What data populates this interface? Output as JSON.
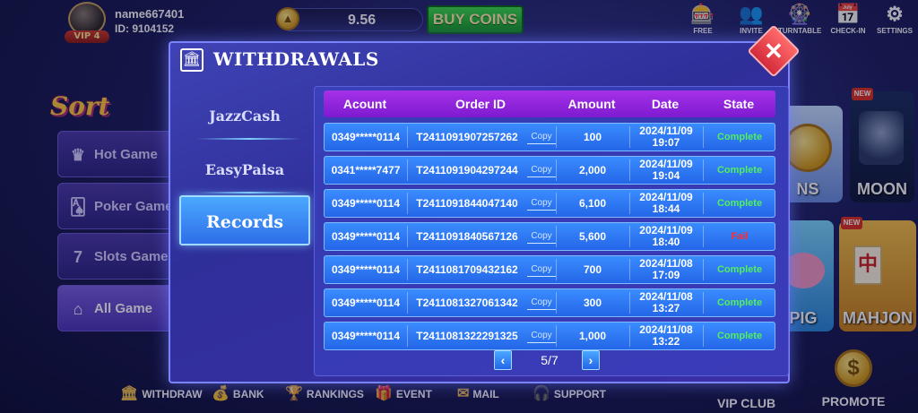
{
  "user": {
    "name": "name667401",
    "id": "ID: 9104152",
    "vip": "VIP 4"
  },
  "balance": "9.56",
  "buy_coins": "BUY COINS",
  "top_icons": [
    {
      "label": "FREE",
      "icon": "slot-machine-icon",
      "glyph": "🎰"
    },
    {
      "label": "INVITE",
      "icon": "invite-icon",
      "glyph": "👥"
    },
    {
      "label": "TURNTABLE",
      "icon": "turntable-icon",
      "glyph": "🎡"
    },
    {
      "label": "CHECK-IN",
      "icon": "checkin-icon",
      "glyph": "📅"
    },
    {
      "label": "SETTINGS",
      "icon": "gear-icon",
      "glyph": "⚙"
    }
  ],
  "sort_label": "Sort",
  "side_menu": [
    {
      "label": "Hot Game",
      "icon": "crown-icon",
      "glyph": "♛"
    },
    {
      "label": "Poker Game",
      "icon": "cards-icon",
      "glyph": "🂡"
    },
    {
      "label": "Slots Game",
      "icon": "slots-icon",
      "glyph": "7"
    },
    {
      "label": "All Game",
      "icon": "home-icon",
      "glyph": "⌂"
    }
  ],
  "tiles": [
    {
      "label": "NS"
    },
    {
      "label": "MOON"
    },
    {
      "label": "PIG"
    },
    {
      "label": "MAHJON"
    }
  ],
  "new_label": "NEW",
  "bottom_bar": [
    {
      "label": "WITHDRAW",
      "icon": "withdraw-icon",
      "glyph": "🏛"
    },
    {
      "label": "BANK",
      "icon": "bank-icon",
      "glyph": "💰"
    },
    {
      "label": "RANKINGS",
      "icon": "trophy-icon",
      "glyph": "🏆"
    },
    {
      "label": "EVENT",
      "icon": "gift-icon",
      "glyph": "🎁"
    },
    {
      "label": "MAIL",
      "icon": "mail-icon",
      "glyph": "✉"
    },
    {
      "label": "SUPPORT",
      "icon": "support-icon",
      "glyph": "🎧"
    }
  ],
  "vip_club": "VIP CLUB",
  "promote": "PROMOTE",
  "modal": {
    "title": "WITHDRAWALS",
    "tabs": [
      "JazzCash",
      "EasyPaisa",
      "Records"
    ],
    "active_tab": 2,
    "columns": [
      "Acount",
      "Order ID",
      "Amount",
      "Date",
      "State"
    ],
    "copy_label": "Copy",
    "rows": [
      {
        "account": "0349*****0114",
        "order_id": "T2411091907257262",
        "amount": "100",
        "date": "2024/11/09",
        "time": "19:07",
        "state": "Complete"
      },
      {
        "account": "0341*****7477",
        "order_id": "T2411091904297244",
        "amount": "2,000",
        "date": "2024/11/09",
        "time": "19:04",
        "state": "Complete"
      },
      {
        "account": "0349*****0114",
        "order_id": "T2411091844047140",
        "amount": "6,100",
        "date": "2024/11/09",
        "time": "18:44",
        "state": "Complete"
      },
      {
        "account": "0349*****0114",
        "order_id": "T2411091840567126",
        "amount": "5,600",
        "date": "2024/11/09",
        "time": "18:40",
        "state": "Fail"
      },
      {
        "account": "0349*****0114",
        "order_id": "T2411081709432162",
        "amount": "700",
        "date": "2024/11/08",
        "time": "17:09",
        "state": "Complete"
      },
      {
        "account": "0349*****0114",
        "order_id": "T2411081327061342",
        "amount": "300",
        "date": "2024/11/08",
        "time": "13:27",
        "state": "Complete"
      },
      {
        "account": "0349*****0114",
        "order_id": "T2411081322291325",
        "amount": "1,000",
        "date": "2024/11/08",
        "time": "13:22",
        "state": "Complete"
      }
    ],
    "page": "5/7",
    "prev_glyph": "‹",
    "next_glyph": "›",
    "close_glyph": "✕",
    "title_glyph": "🏛"
  }
}
